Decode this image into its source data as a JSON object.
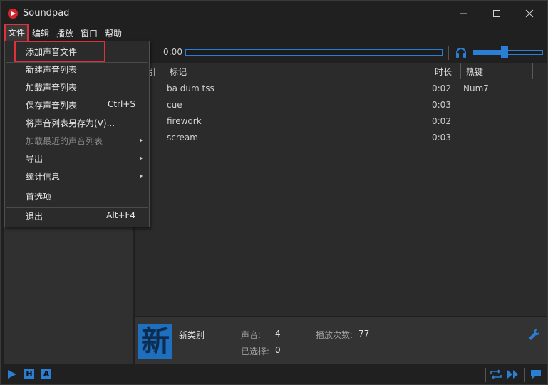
{
  "app": {
    "title": "Soundpad"
  },
  "menubar": {
    "items": [
      "文件",
      "编辑",
      "播放",
      "窗口",
      "帮助"
    ]
  },
  "toolbar": {
    "time": "0:00",
    "progress": 0.0,
    "volume": 0.45
  },
  "table": {
    "columns": [
      "引",
      "标记",
      "时长",
      "热键"
    ],
    "rows": [
      {
        "title": "ba dum tss",
        "duration": "0:02",
        "hotkey": "Num7"
      },
      {
        "title": "cue",
        "duration": "0:03",
        "hotkey": ""
      },
      {
        "title": "firework",
        "duration": "0:02",
        "hotkey": ""
      },
      {
        "title": "scream",
        "duration": "0:03",
        "hotkey": ""
      }
    ]
  },
  "category": {
    "badge": "新",
    "name": "新类别",
    "sounds_label": "声音:",
    "sounds_value": "4",
    "selected_label": "已选择:",
    "selected_value": "0",
    "plays_label": "播放次数:",
    "plays_value": "77"
  },
  "bottombar": {
    "h_label": "H",
    "a_label": "A"
  },
  "file_menu": {
    "items": [
      {
        "label": "添加声音文件",
        "shortcut": "",
        "submenu": false,
        "disabled": false
      },
      {
        "label": "新建声音列表",
        "shortcut": "",
        "submenu": false,
        "disabled": false
      },
      {
        "label": "加载声音列表",
        "shortcut": "",
        "submenu": false,
        "disabled": false
      },
      {
        "label": "保存声音列表",
        "shortcut": "Ctrl+S",
        "submenu": false,
        "disabled": false
      },
      {
        "label": "将声音列表另存为(V)...",
        "shortcut": "",
        "submenu": false,
        "disabled": false
      },
      {
        "label": "加载最近的声音列表",
        "shortcut": "",
        "submenu": true,
        "disabled": true
      },
      {
        "label": "导出",
        "shortcut": "",
        "submenu": true,
        "disabled": false
      },
      {
        "label": "统计信息",
        "shortcut": "",
        "submenu": true,
        "disabled": false
      },
      {
        "label": "首选项",
        "shortcut": "",
        "submenu": false,
        "disabled": false
      },
      {
        "label": "退出",
        "shortcut": "Alt+F4",
        "submenu": false,
        "disabled": false
      }
    ]
  },
  "colors": {
    "accent": "#2a7fd4",
    "highlight": "#e0303a",
    "brand": "#d6242d"
  }
}
